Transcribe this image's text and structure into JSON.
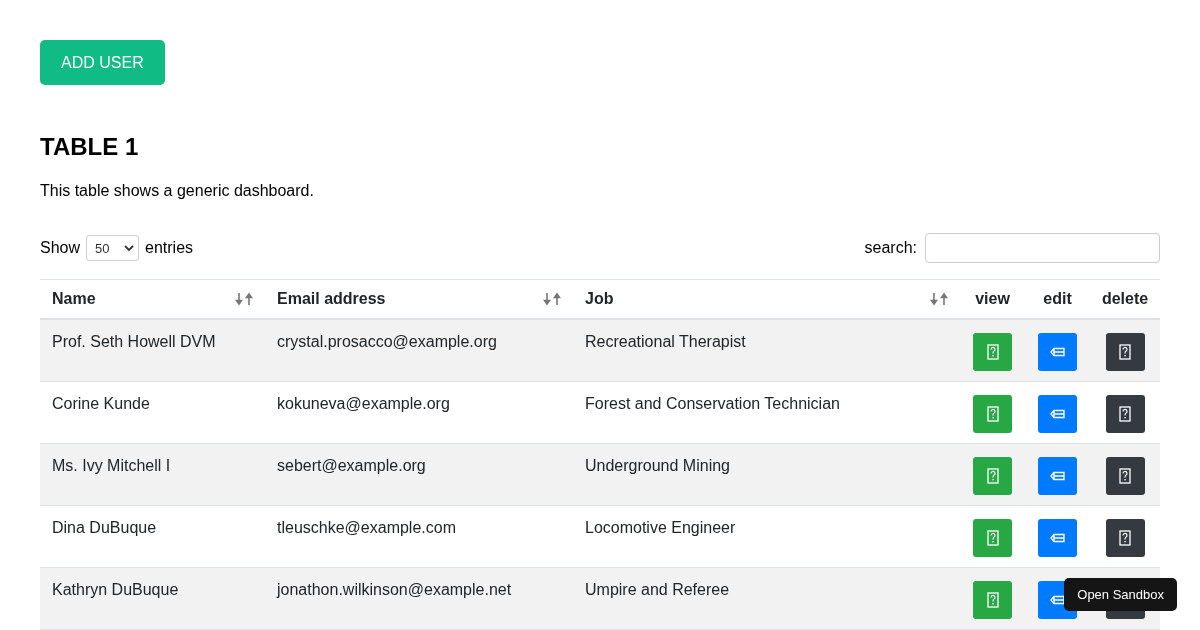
{
  "add_button": "ADD USER",
  "title": "TABLE 1",
  "description": "This table shows a generic dashboard.",
  "length": {
    "show": "Show",
    "value": "50",
    "entries": "entries"
  },
  "search": {
    "label": "search:"
  },
  "table": {
    "columns": [
      {
        "label": "Name",
        "sortable": true
      },
      {
        "label": "Email address",
        "sortable": true
      },
      {
        "label": "Job",
        "sortable": true
      },
      {
        "label": "view",
        "sortable": false
      },
      {
        "label": "edit",
        "sortable": false
      },
      {
        "label": "delete",
        "sortable": false
      }
    ],
    "rows": [
      {
        "name": "Prof. Seth Howell DVM",
        "email": "crystal.prosacco@example.org",
        "job": "Recreational Therapist"
      },
      {
        "name": "Corine Kunde",
        "email": "kokuneva@example.org",
        "job": "Forest and Conservation Technician"
      },
      {
        "name": "Ms. Ivy Mitchell I",
        "email": "sebert@example.org",
        "job": "Underground Mining"
      },
      {
        "name": "Dina DuBuque",
        "email": "tleuschke@example.com",
        "job": "Locomotive Engineer"
      },
      {
        "name": "Kathryn DuBuque",
        "email": "jonathon.wilkinson@example.net",
        "job": "Umpire and Referee"
      }
    ]
  },
  "sandbox_button": "Open Sandbox"
}
